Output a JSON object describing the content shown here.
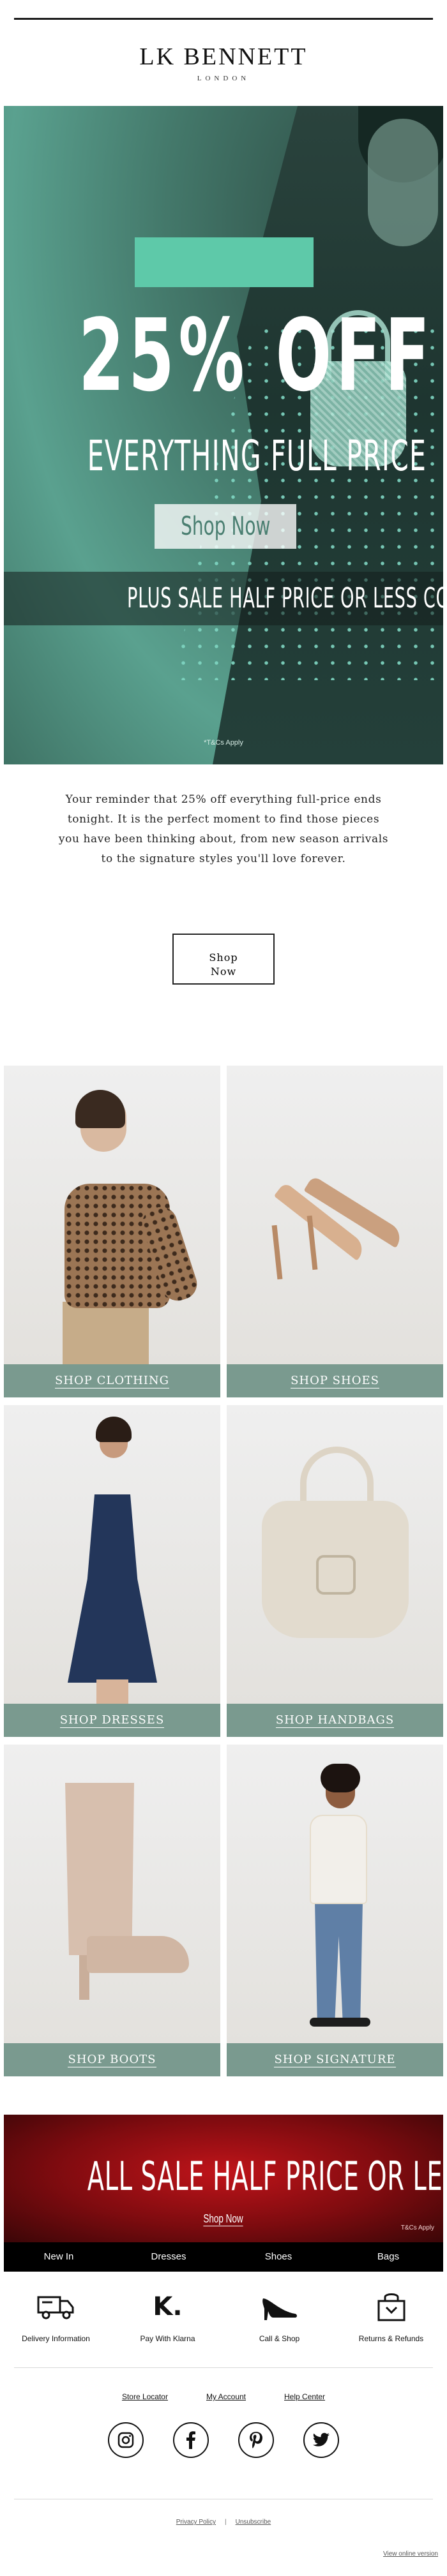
{
  "header": {
    "brand": "LK BENNETT",
    "subbrand": "LONDON"
  },
  "hero": {
    "headline": "25% OFF",
    "subheadline": "EVERYTHING FULL PRICE",
    "cta_label": "Shop Now",
    "band_text": "PLUS SALE HALF PRICE OR LESS CONTINUES",
    "terms": "*T&Cs Apply"
  },
  "intro": {
    "text": "Your reminder that 25% off everything full-price ends tonight. It is the perfect moment to find those pieces you have been thinking about, from new season arrivals to the signature styles you'll love forever.",
    "cta_line1": "Shop",
    "cta_line2": "Now"
  },
  "categories": [
    {
      "label": "SHOP CLOTHING"
    },
    {
      "label": "SHOP SHOES"
    },
    {
      "label": "SHOP DRESSES"
    },
    {
      "label": "SHOP HANDBAGS"
    },
    {
      "label": "SHOP BOOTS"
    },
    {
      "label": "SHOP SIGNATURE"
    }
  ],
  "sale_banner": {
    "title": "ALL SALE HALF PRICE OR LESS",
    "cta_label": "Shop Now",
    "terms": "T&Cs Apply"
  },
  "nav": {
    "items": [
      "New In",
      "Dresses",
      "Shoes",
      "Bags"
    ]
  },
  "services": [
    {
      "label": "Delivery Information",
      "icon": "truck-icon"
    },
    {
      "label": "Pay With Klarna",
      "icon": "klarna-icon",
      "glyph": "K."
    },
    {
      "label": "Call & Shop",
      "icon": "heel-shoe-icon"
    },
    {
      "label": "Returns & Refunds",
      "icon": "shopping-bag-icon"
    }
  ],
  "footer": {
    "links": [
      "Store Locator",
      "My Account",
      "Help Center"
    ],
    "social": [
      "instagram-icon",
      "facebook-icon",
      "pinterest-icon",
      "twitter-icon"
    ],
    "privacy_label": "Privacy Policy",
    "separator": "|",
    "unsubscribe_label": "Unsubscribe",
    "browser_label": "View online version"
  },
  "colors": {
    "hero_green": "#4d8f7e",
    "accent_teal": "#5ec9a9",
    "tile_label_bg": "#7a9a8f",
    "sale_red": "#c0141a",
    "nav_bg": "#000000"
  }
}
